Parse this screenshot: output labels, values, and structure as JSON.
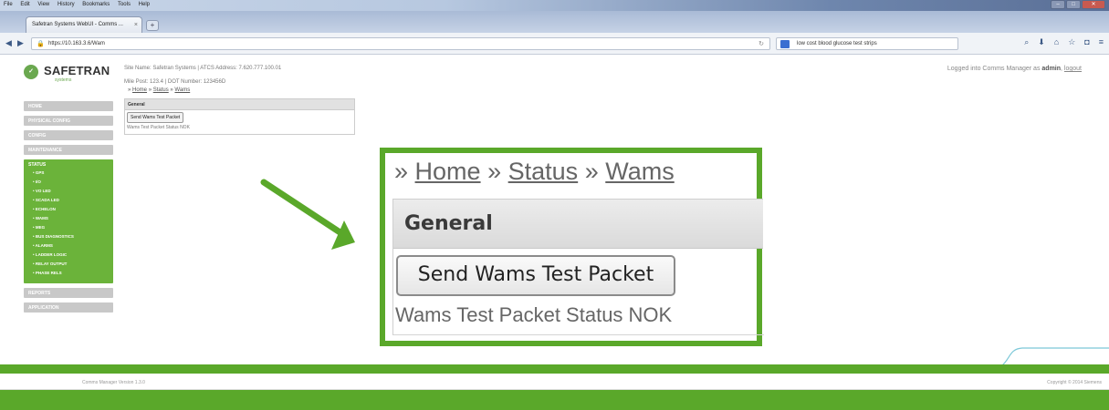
{
  "browser": {
    "menu": [
      "File",
      "Edit",
      "View",
      "History",
      "Bookmarks",
      "Tools",
      "Help"
    ],
    "tab_title": "Safetran Systems WebUI - Comms ...",
    "tab_close": "×",
    "new_tab": "+",
    "url": "https://10.163.3.6/Wam",
    "search_text": "low cost blood glucose test strips",
    "win_controls": [
      "–",
      "□",
      "✕"
    ]
  },
  "header": {
    "logo_text": "SAFETRAN",
    "logo_sub": "systems",
    "site_name_line": "Site Name: Safetran Systems | ATCS Address: 7.620.777.100.01",
    "milepost_line": "Mile Post: 123.4          | DOT Number: 123456D",
    "login_prefix": "Logged into Comms Manager as",
    "login_user": "admin",
    "logout_label": "logout"
  },
  "breadcrumb": {
    "sep": "»",
    "items": [
      "Home",
      "Status",
      "Wams"
    ]
  },
  "panel": {
    "header": "General",
    "button_label": "Send Wams Test Packet",
    "status_text": "Wams Test Packet Status NOK"
  },
  "sidebar": {
    "top_items": [
      "HOME",
      "PHYSICAL CONFIG",
      "CONFIG",
      "MAINTENANCE"
    ],
    "status_group": {
      "title": "STATUS",
      "items": [
        "GPS",
        "I/O",
        "VO LED",
        "SCADA LED",
        "ECHELON",
        "WAMS",
        "MEG",
        "BUS DIAGNOSTICS",
        "ALARMS",
        "LADDER LOGIC",
        "RELAY OUTPUT",
        "PHASE RELS"
      ]
    },
    "bottom_items": [
      "REPORTS",
      "APPLICATION"
    ]
  },
  "footer": {
    "version": "Comms Manager Version 1.3.0",
    "copyright": "Copyright © 2014 Siemens"
  },
  "colors": {
    "brand_green": "#5aa82a",
    "sidebar_green": "#6bb33a"
  }
}
